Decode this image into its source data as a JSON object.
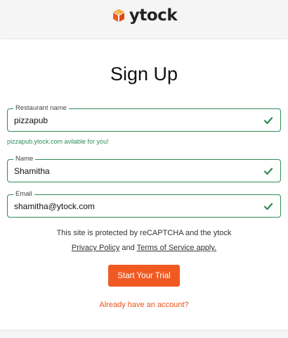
{
  "brand": {
    "name": "ytock",
    "accent": "#f05a22"
  },
  "page_title": "Sign Up",
  "form": {
    "restaurant": {
      "label": "Restaurant name",
      "value": "pizzapub",
      "valid": true
    },
    "availability_hint": "pizzapub.ytock.com avilable for you!",
    "name": {
      "label": "Name",
      "value": "Shamitha",
      "valid": true
    },
    "email": {
      "label": "Email",
      "value": "shamitha@ytock.com",
      "valid": true
    }
  },
  "recaptcha": {
    "line1": "This site is protected by reCAPTCHA and the ytock",
    "privacy_link": "Privacy Policy",
    "and": "and",
    "terms_link": "Terms of Service apply."
  },
  "cta_label": "Start Your Trial",
  "login_link": "Already have an account?",
  "colors": {
    "valid_green": "#2e8b57",
    "cta_orange": "#f05a22",
    "link_orange": "#e8541c"
  },
  "icons": {
    "logo": "cube-logo-icon",
    "valid": "check-icon"
  }
}
